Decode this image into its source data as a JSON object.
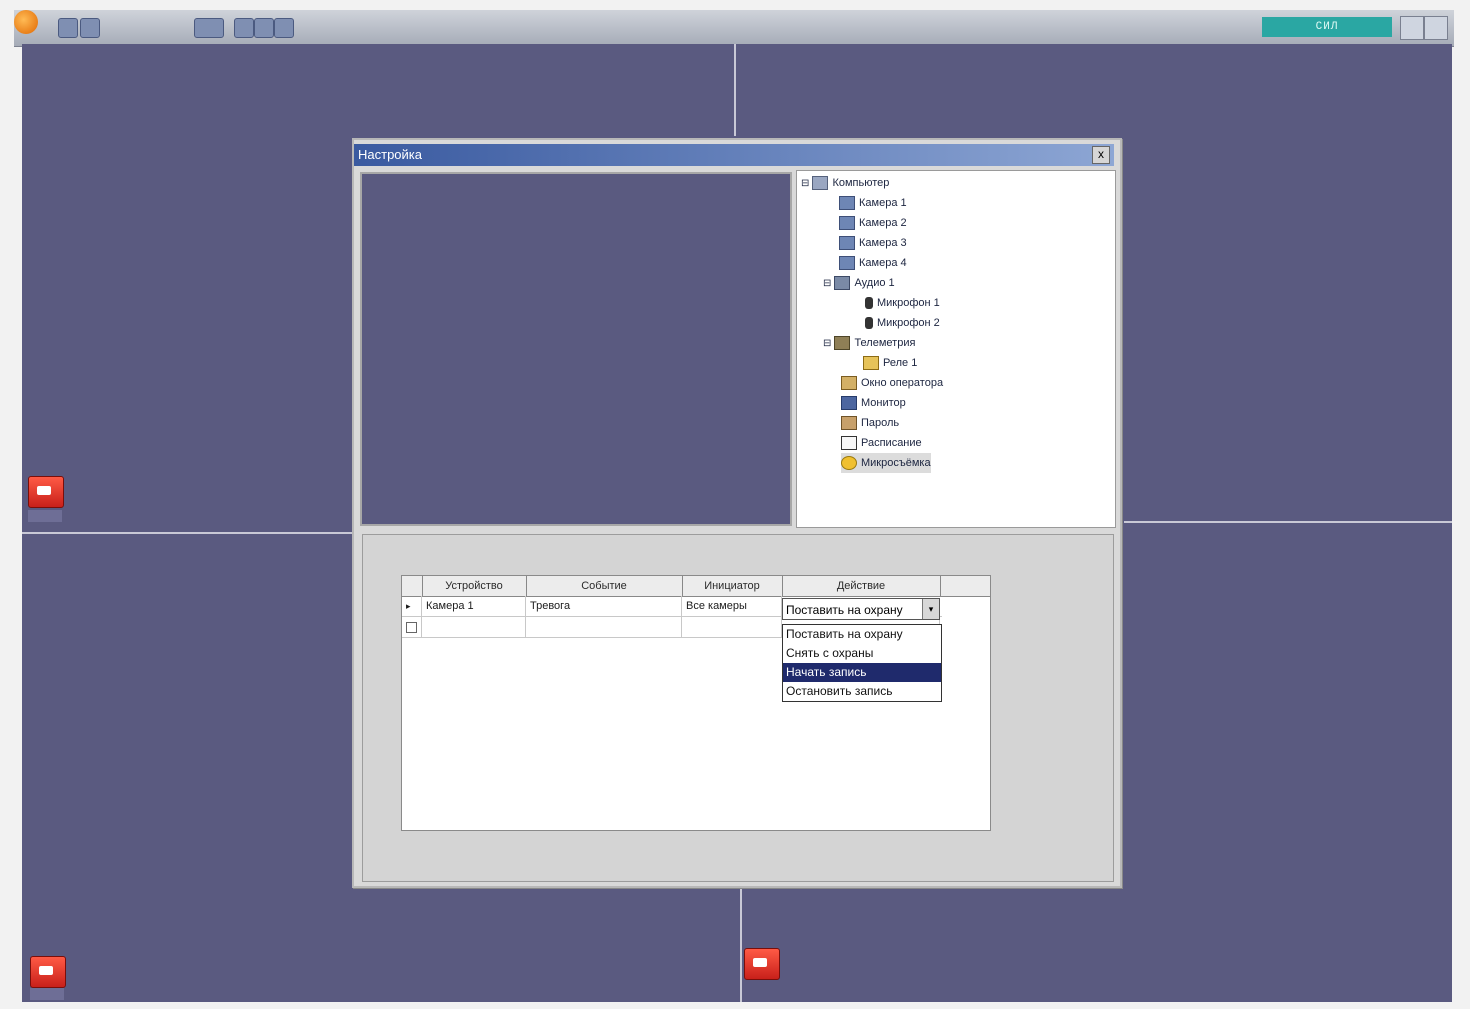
{
  "status_text": "СИЛ",
  "dialog": {
    "title": "Настройка",
    "close_glyph": "x"
  },
  "tree": [
    {
      "label": "Компьютер",
      "icon": "computer-icon",
      "expand": "⊟"
    },
    {
      "label": "Камера 1",
      "icon": "camera-icon"
    },
    {
      "label": "Камера 2",
      "icon": "camera-icon"
    },
    {
      "label": "Камера 3",
      "icon": "camera-icon"
    },
    {
      "label": "Камера 4",
      "icon": "camera-icon"
    },
    {
      "label": "Аудио 1",
      "icon": "audio-icon",
      "expand": "⊟"
    },
    {
      "label": "Микрофон 1",
      "icon": "microphone-icon"
    },
    {
      "label": "Микрофон 2",
      "icon": "microphone-icon"
    },
    {
      "label": "Телеметрия",
      "icon": "telemetry-icon",
      "expand": "⊟"
    },
    {
      "label": "Реле 1",
      "icon": "relay-icon"
    },
    {
      "label": "Окно оператора",
      "icon": "operator-icon"
    },
    {
      "label": "Монитор",
      "icon": "monitor-icon"
    },
    {
      "label": "Пароль",
      "icon": "password-icon"
    },
    {
      "label": "Расписание",
      "icon": "schedule-icon"
    },
    {
      "label": "Микросъёмка",
      "icon": "microshoot-icon"
    }
  ],
  "table": {
    "headers": [
      "Устройство",
      "Событие",
      "Инициатор",
      "Действие"
    ],
    "rows": [
      {
        "device": "Камера 1",
        "event": "Тревога",
        "initiator": "Все камеры",
        "action": "Поставить на охрану"
      },
      {
        "device": "",
        "event": "",
        "initiator": "",
        "action": ""
      }
    ],
    "row_markers": [
      "▸",
      ""
    ],
    "dropdown_arrow": "▾",
    "dropdown_options": [
      "Поставить на охрану",
      "Снять с охраны",
      "Начать запись",
      "Остановить запись"
    ],
    "selected_option_index": 2
  }
}
